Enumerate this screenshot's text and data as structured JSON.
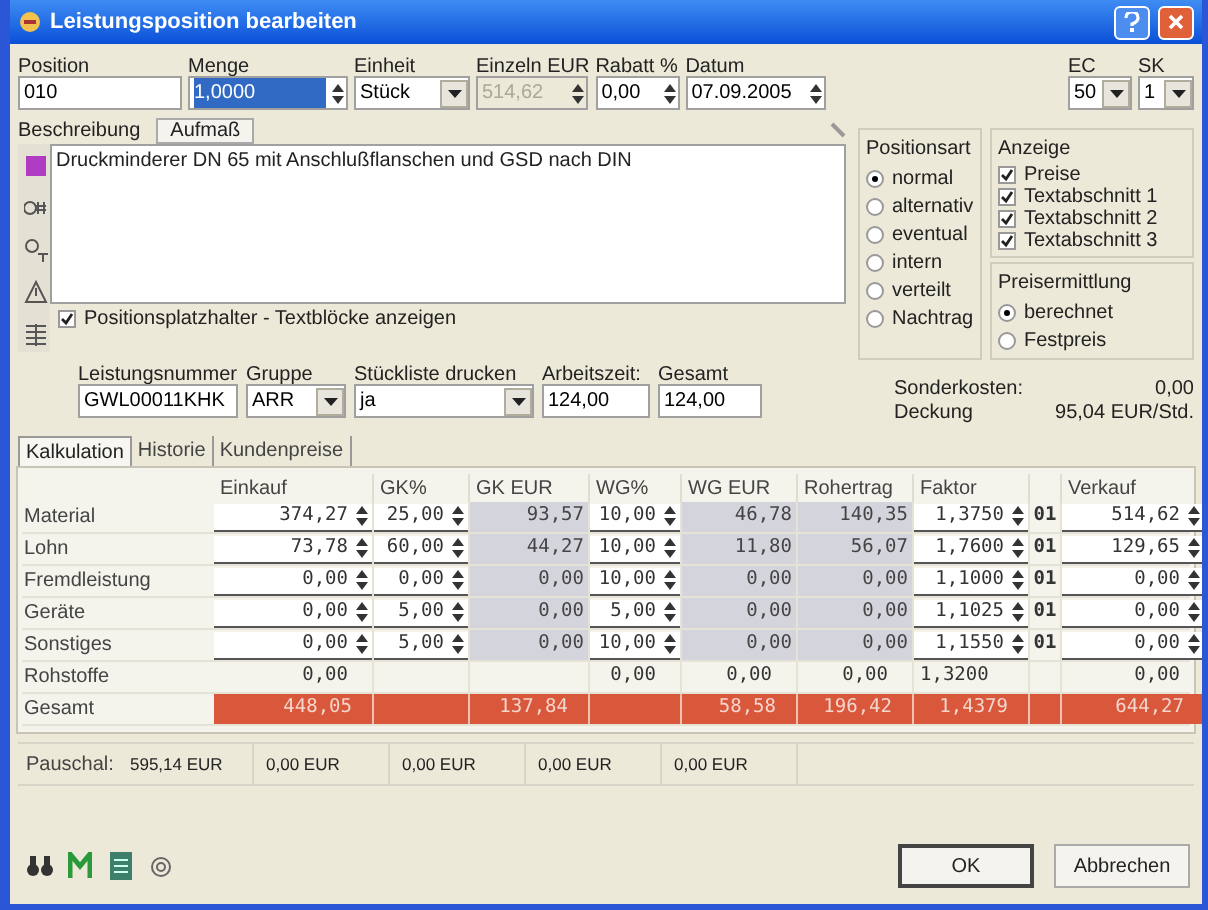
{
  "window": {
    "title": "Leistungsposition bearbeiten"
  },
  "header_fields": [
    {
      "label": "Position",
      "value": "010",
      "kind": "text"
    },
    {
      "label": "Menge",
      "value": "1,0000",
      "kind": "spin",
      "selected": true,
      "disabled": false
    },
    {
      "label": "Einheit",
      "value": "Stück",
      "kind": "select"
    },
    {
      "label": "Einzeln EUR",
      "value": "514,62",
      "kind": "spin",
      "selected": false,
      "disabled": true
    },
    {
      "label": "Rabatt %",
      "value": "0,00",
      "kind": "spin",
      "selected": false,
      "disabled": false
    },
    {
      "label": "Datum",
      "value": "07.09.2005",
      "kind": "spin",
      "selected": false,
      "disabled": false
    }
  ],
  "right_fields": [
    {
      "label": "EC",
      "value": "50"
    },
    {
      "label": "SK",
      "value": "1"
    }
  ],
  "description": {
    "label": "Beschreibung",
    "button": "Aufmaß",
    "text": "Druckminderer DN 65 mit Anschlußflanschen und GSD nach DIN"
  },
  "placeholder_checkbox": {
    "label": "Positionsplatzhalter - Textblöcke anzeigen",
    "checked": true
  },
  "positionsart": {
    "title": "Positionsart",
    "options": [
      {
        "label": "normal",
        "selected": true
      },
      {
        "label": "alternativ",
        "selected": false
      },
      {
        "label": "eventual",
        "selected": false
      },
      {
        "label": "intern",
        "selected": false
      },
      {
        "label": "verteilt",
        "selected": false
      },
      {
        "label": "Nachtrag",
        "selected": false
      }
    ]
  },
  "anzeige": {
    "title": "Anzeige",
    "checks": [
      {
        "label": "Preise",
        "checked": true
      },
      {
        "label": "Textabschnitt 1",
        "checked": true
      },
      {
        "label": "Textabschnitt 2",
        "checked": true
      },
      {
        "label": "Textabschnitt 3",
        "checked": true
      }
    ]
  },
  "preisermittlung": {
    "title": "Preisermittlung",
    "options": [
      {
        "label": "berechnet",
        "selected": true
      },
      {
        "label": "Festpreis",
        "selected": false
      }
    ]
  },
  "second_fields": [
    {
      "label": "Leistungsnummer",
      "value": "GWL00011KHK",
      "kind": "text"
    },
    {
      "label": "Gruppe",
      "value": "ARR",
      "kind": "select"
    },
    {
      "label": "Stückliste drucken",
      "value": "ja",
      "kind": "select"
    },
    {
      "label": "Arbeitszeit:",
      "value": "124,00",
      "kind": "text"
    },
    {
      "label": "Gesamt",
      "value": "124,00",
      "kind": "text"
    }
  ],
  "summary": [
    {
      "label": "Sonderkosten:",
      "value": "0,00"
    },
    {
      "label": "Deckung",
      "value": "95,04 EUR/Std."
    }
  ],
  "tabs": [
    {
      "label": "Kalkulation",
      "selected": true
    },
    {
      "label": "Historie",
      "selected": false
    },
    {
      "label": "Kundenpreise",
      "selected": false
    }
  ],
  "table": {
    "columns": [
      "Einkauf",
      "GK%",
      "GK EUR",
      "WG%",
      "WG EUR",
      "Rohertrag",
      "Faktor",
      "",
      "Verkauf"
    ],
    "rows": [
      {
        "label": "Material",
        "cells": [
          {
            "kind": "spin",
            "text": "374,27"
          },
          {
            "kind": "spin",
            "text": "25,00"
          },
          {
            "kind": "gray",
            "text": "93,57"
          },
          {
            "kind": "spin",
            "text": "10,00"
          },
          {
            "kind": "gray",
            "text": "46,78"
          },
          {
            "kind": "gray",
            "text": "140,35"
          },
          {
            "kind": "spin",
            "text": "1,3750"
          },
          {
            "kind": "code",
            "text": "01"
          },
          {
            "kind": "spin",
            "text": "514,62"
          }
        ]
      },
      {
        "label": "Lohn",
        "cells": [
          {
            "kind": "spin",
            "text": "73,78"
          },
          {
            "kind": "spin",
            "text": "60,00"
          },
          {
            "kind": "gray",
            "text": "44,27"
          },
          {
            "kind": "spin",
            "text": "10,00"
          },
          {
            "kind": "gray",
            "text": "11,80"
          },
          {
            "kind": "gray",
            "text": "56,07"
          },
          {
            "kind": "spin",
            "text": "1,7600"
          },
          {
            "kind": "code",
            "text": "01"
          },
          {
            "kind": "spin",
            "text": "129,65"
          }
        ]
      },
      {
        "label": "Fremdleistung",
        "cells": [
          {
            "kind": "spin",
            "text": "0,00"
          },
          {
            "kind": "spin",
            "text": "0,00"
          },
          {
            "kind": "gray",
            "text": "0,00"
          },
          {
            "kind": "spin",
            "text": "10,00"
          },
          {
            "kind": "gray",
            "text": "0,00"
          },
          {
            "kind": "gray",
            "text": "0,00"
          },
          {
            "kind": "spin",
            "text": "1,1000"
          },
          {
            "kind": "code",
            "text": "01"
          },
          {
            "kind": "spin",
            "text": "0,00"
          }
        ]
      },
      {
        "label": "Geräte",
        "cells": [
          {
            "kind": "spin",
            "text": "0,00"
          },
          {
            "kind": "spin",
            "text": "5,00"
          },
          {
            "kind": "gray",
            "text": "0,00"
          },
          {
            "kind": "spin",
            "text": "5,00"
          },
          {
            "kind": "gray",
            "text": "0,00"
          },
          {
            "kind": "gray",
            "text": "0,00"
          },
          {
            "kind": "spin",
            "text": "1,1025"
          },
          {
            "kind": "code",
            "text": "01"
          },
          {
            "kind": "spin",
            "text": "0,00"
          }
        ]
      },
      {
        "label": "Sonstiges",
        "cells": [
          {
            "kind": "spin",
            "text": "0,00"
          },
          {
            "kind": "spin",
            "text": "5,00"
          },
          {
            "kind": "gray",
            "text": "0,00"
          },
          {
            "kind": "spin",
            "text": "10,00"
          },
          {
            "kind": "gray",
            "text": "0,00"
          },
          {
            "kind": "gray",
            "text": "0,00"
          },
          {
            "kind": "spin",
            "text": "1,1550"
          },
          {
            "kind": "code",
            "text": "01"
          },
          {
            "kind": "spin",
            "text": "0,00"
          }
        ]
      },
      {
        "label": "Rohstoffe",
        "cells": [
          {
            "kind": "plain",
            "text": "0,00"
          },
          {
            "kind": "blank"
          },
          {
            "kind": "blank"
          },
          {
            "kind": "plain",
            "text": "0,00"
          },
          {
            "kind": "plain",
            "text": "0,00"
          },
          {
            "kind": "plain",
            "text": "0,00"
          },
          {
            "kind": "plainleft",
            "text": "1,3200"
          },
          {
            "kind": "blank"
          },
          {
            "kind": "plain",
            "text": "0,00"
          }
        ]
      },
      {
        "label": "Gesamt",
        "cells": [
          {
            "kind": "total",
            "text": "448,05"
          },
          {
            "kind": "totalblank"
          },
          {
            "kind": "total",
            "text": "137,84"
          },
          {
            "kind": "totalblank"
          },
          {
            "kind": "total",
            "text": "58,58"
          },
          {
            "kind": "total",
            "text": "196,42"
          },
          {
            "kind": "total",
            "text": "1,4379"
          },
          {
            "kind": "totalblank"
          },
          {
            "kind": "total",
            "text": "644,27"
          }
        ]
      }
    ]
  },
  "pauschal": {
    "label": "Pauschal:",
    "values": [
      "595,14 EUR",
      "0,00 EUR",
      "0,00 EUR",
      "0,00 EUR",
      "0,00 EUR"
    ]
  },
  "buttons": [
    {
      "label": "OK",
      "kind": "default"
    },
    {
      "label": "Abbrechen",
      "kind": "normal"
    }
  ]
}
